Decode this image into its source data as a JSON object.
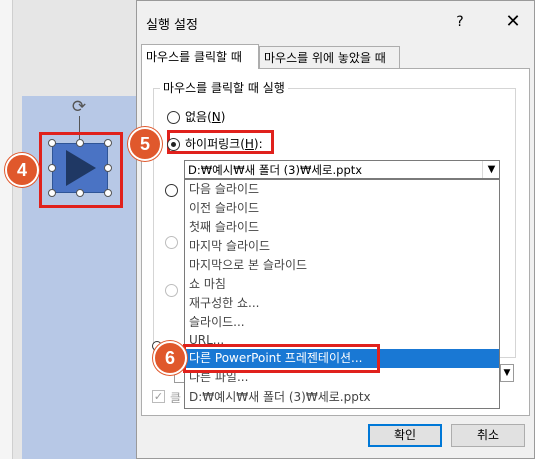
{
  "dialog": {
    "title": "실행 설정",
    "help_label": "?",
    "close_label": "✕",
    "tabs": [
      {
        "label": "마우스를 클릭할 때",
        "selected": true
      },
      {
        "label": "마우스를 위에 놓았을 때",
        "selected": false
      }
    ],
    "group_label": "마우스를 클릭할 때 실행",
    "radio_none": {
      "text": "없음(",
      "key": "N",
      "suffix": ")",
      "checked": false
    },
    "radio_hyperlink": {
      "text": "하이퍼링크(",
      "key": "H",
      "suffix": "):",
      "checked": true
    },
    "hyperlink_combo_value": "D:₩예시₩새 폴더 (3)₩세로.pptx",
    "dropdown_options": [
      "다음 슬라이드",
      "이전 슬라이드",
      "첫째 슬라이드",
      "마지막 슬라이드",
      "마지막으로 본 슬라이드",
      "쇼 마침",
      "재구성한 쇼...",
      "슬라이드...",
      "URL...",
      "다른 PowerPoint 프레젠테이션...",
      "다른 파일...",
      "D:₩예시₩새 폴더 (3)₩세로.pptx"
    ],
    "highlighted_option_index": 9,
    "check_partial_label": "클",
    "ok_label": "확인",
    "cancel_label": "취소"
  },
  "badges": {
    "step4": "4",
    "step5": "5",
    "step6": "6"
  },
  "colors": {
    "badge": "#e0582c",
    "highlight_box": "#e0211c",
    "selection": "#1978d4",
    "shape_fill": "#4a73c4",
    "slide_bg": "#b7c8e6"
  },
  "icons": {
    "rotate": "rotate-handle-icon",
    "play": "play-icon",
    "dropdown": "chevron-down-icon",
    "check": "checkmark-icon"
  }
}
